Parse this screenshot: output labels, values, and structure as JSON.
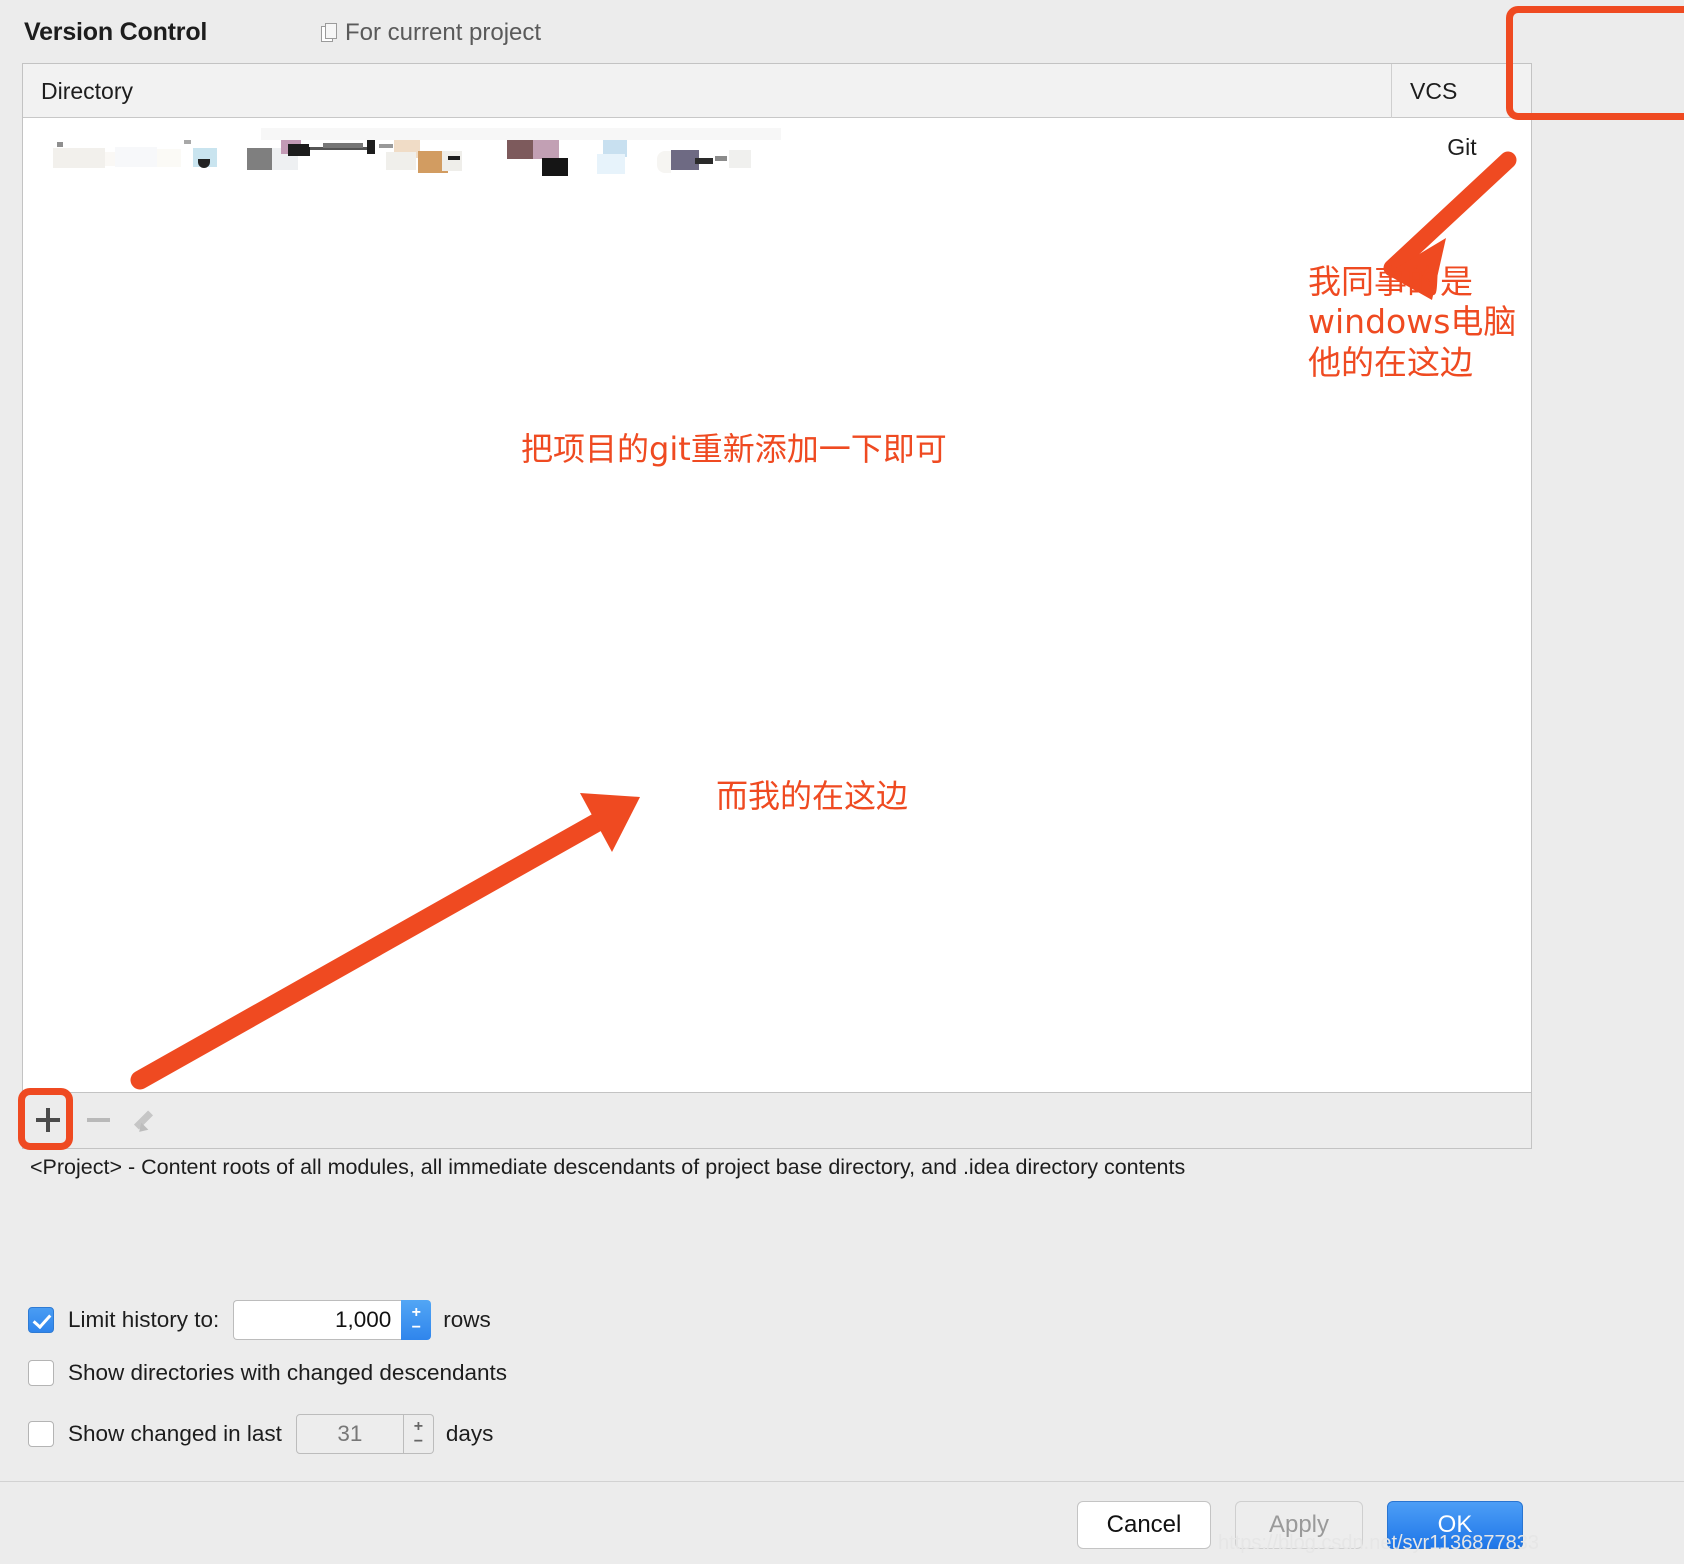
{
  "header": {
    "title": "Version Control",
    "scope_label": "For current project",
    "scope_icon": "copy-icon"
  },
  "table": {
    "columns": [
      "Directory",
      "VCS"
    ],
    "rows": [
      {
        "directory": "",
        "directory_state": "censored-mosaic",
        "vcs": "Git"
      }
    ]
  },
  "toolbar": {
    "add_label": "+",
    "remove_label": "−",
    "edit_label": "edit-pencil",
    "add_icon": "plus-icon",
    "remove_icon": "minus-icon",
    "edit_icon": "pencil-icon"
  },
  "description": "<Project> - Content roots of all modules, all immediate descendants of project base directory, and .idea directory contents",
  "options": [
    {
      "id": "limit-history",
      "checked": true,
      "label": "Limit history to:",
      "value": "1,000",
      "unit": "rows"
    },
    {
      "id": "show-directories-changed-descendants",
      "checked": false,
      "label": "Show directories with changed descendants"
    },
    {
      "id": "show-changed-in-last",
      "checked": false,
      "label": "Show changed in last",
      "value": "31",
      "unit": "days"
    }
  ],
  "spinner_buttons": {
    "up": "+",
    "down": "−"
  },
  "footer": {
    "cancel": "Cancel",
    "apply": "Apply",
    "ok": "OK"
  },
  "annotations": {
    "colleague": "我同事的是\nwindows电脑\n他的在这边",
    "fix": "把项目的git重新添加一下即可",
    "mine": "而我的在这边"
  },
  "watermark": "https://blog.csdn.net/syr1136877833",
  "colors": {
    "accent_orange": "#ef4a21",
    "primary_blue": "#2f85ec",
    "dialog_bg": "#ececec"
  }
}
